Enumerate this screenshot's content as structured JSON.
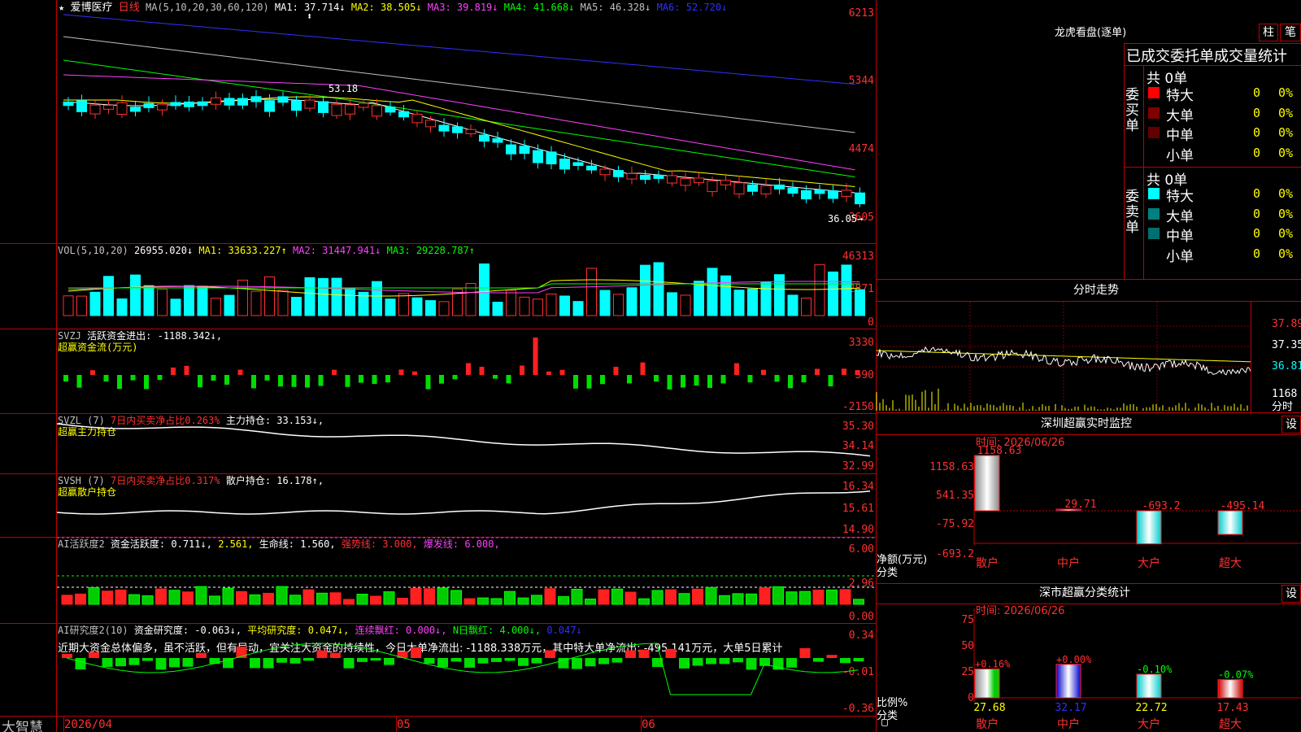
{
  "stock": {
    "star": "★",
    "updown_arrow": "⬍",
    "name": "爱博医疗",
    "period": "日线"
  },
  "ma": {
    "label": "MA(5,10,20,30,60,120)",
    "items": [
      {
        "text": "MA1: 37.714↓",
        "color": "#ffffff"
      },
      {
        "text": "MA2: 38.505↓",
        "color": "#ffff00"
      },
      {
        "text": "MA3: 39.819↓",
        "color": "#ff40ff"
      },
      {
        "text": "MA4: 41.668↓",
        "color": "#00ff00"
      },
      {
        "text": "MA5: 46.328↓",
        "color": "#c0c0c0"
      },
      {
        "text": "MA6: 52.720↓",
        "color": "#3030ff"
      }
    ]
  },
  "price_axis": [
    "6213",
    "5344",
    "4474",
    "3605"
  ],
  "price_marks": {
    "high": "53.18",
    "low": "36.05→"
  },
  "vol": {
    "label": "VOL(5,10,20)",
    "value": "26955.020↓",
    "ma1": "MA1: 33633.227↑",
    "ma2": "MA2: 31447.941↓",
    "ma3": "MA3: 29228.787↑",
    "axis": [
      "46313",
      "22871",
      "0"
    ]
  },
  "svzj": {
    "label": "SVZJ",
    "title": "活跃资金进出: -1188.342↓,",
    "subtitle": "超赢资金流(万元)",
    "axis": [
      "3330",
      "590",
      "-2150"
    ]
  },
  "svzl": {
    "label": "SVZL (7)",
    "ratio": "7日内买卖净占比0.263%",
    "hold": "主力持仓: 33.153↓,",
    "subtitle": "超赢主力持仓",
    "axis": [
      "35.30",
      "34.14",
      "32.99"
    ]
  },
  "svsh": {
    "label": "SVSH (7)",
    "ratio": "7日内买卖净占比0.317%",
    "hold": "散户持仓: 16.178↑,",
    "subtitle": "超赢散户持仓",
    "axis": [
      "16.34",
      "15.61",
      "14.90"
    ]
  },
  "ai_active": {
    "label": "AI活跃度2",
    "activity": "资金活跃度: 0.711↓,",
    "v2": "2.561,",
    "life": "生命线: 1.560,",
    "strong": "强势线: 3.000,",
    "burst": "爆发线: 6.000,",
    "axis": [
      "6.00",
      "2.96",
      "0.00"
    ]
  },
  "ai_research": {
    "label": "AI研究度2(10)",
    "research": "资金研究度: -0.063↓,",
    "avg": "平均研究度: 0.047↓,",
    "consec": "连续飘红: 0.000↓,",
    "nday": "N日飘红: 4.000↓,",
    "last": "0.047↓",
    "comment": "近期大资金总体偏多，虽不活跃，但有异动，宜关注大资金的持续性，今日大单净流出: -1188.338万元，其中特大单净流出: -495.141万元，大单5日累计",
    "axis": [
      "0.34",
      "-0.01",
      "-0.36"
    ]
  },
  "date_axis": [
    "2026/04",
    "05",
    "06"
  ],
  "brand": "大智慧",
  "dragon": {
    "title": "龙虎看盘(逐单)",
    "tab_bar": "柱",
    "tab_pen": "笔",
    "subtitle": "已成交委托单成交量统计",
    "buy_label": "委买单",
    "sell_label": "委卖单",
    "buy_total": "共 0单",
    "sell_total": "共 0单",
    "buy_rows": [
      {
        "name": "特大",
        "val": "0",
        "pct": "0%",
        "color": "#ff0000"
      },
      {
        "name": "大单",
        "val": "0",
        "pct": "0%",
        "color": "#800000"
      },
      {
        "name": "中单",
        "val": "0",
        "pct": "0%",
        "color": "#600000"
      },
      {
        "name": "小单",
        "val": "0",
        "pct": "0%",
        "color": "#000000"
      }
    ],
    "sell_rows": [
      {
        "name": "特大",
        "val": "0",
        "pct": "0%",
        "color": "#00ffff"
      },
      {
        "name": "大单",
        "val": "0",
        "pct": "0%",
        "color": "#008080"
      },
      {
        "name": "中单",
        "val": "0",
        "pct": "0%",
        "color": "#007070"
      },
      {
        "name": "小单",
        "val": "0",
        "pct": "0%",
        "color": "#000000"
      }
    ]
  },
  "intraday": {
    "title": "分时走势",
    "axis": [
      "37.89",
      "37.35",
      "36.81",
      "1168"
    ],
    "footer": "分时"
  },
  "sz_monitor": {
    "title": "深圳超赢实时监控",
    "settings": "设",
    "time": "时间: 2026/06/26",
    "axis": [
      "1158.63",
      "541.35",
      "-75.92",
      "-693.2"
    ],
    "y_caption": "净额(万元)",
    "x_caption": "分类",
    "bars": [
      {
        "label": "散户",
        "value": "1158.63"
      },
      {
        "label": "中户",
        "value": "29.71"
      },
      {
        "label": "大户",
        "value": "-693.2"
      },
      {
        "label": "超大",
        "value": "-495.14"
      }
    ]
  },
  "sz_stats": {
    "title": "深市超赢分类统计",
    "settings": "设",
    "time": "时间: 2026/06/26",
    "axis": [
      "75",
      "50",
      "25",
      "0"
    ],
    "y_caption": "比例%",
    "x_caption": "分类",
    "bars": [
      {
        "label": "散户",
        "value": "27.68",
        "change": "+0.16%"
      },
      {
        "label": "中户",
        "value": "32.17",
        "change": "+0.00%"
      },
      {
        "label": "大户",
        "value": "22.72",
        "change": "-0.10%"
      },
      {
        "label": "超大",
        "value": "17.43",
        "change": "-0.07%"
      }
    ]
  },
  "colors": {
    "up": "#ff0000",
    "down": "#00ffff",
    "frame": "#c00000"
  }
}
